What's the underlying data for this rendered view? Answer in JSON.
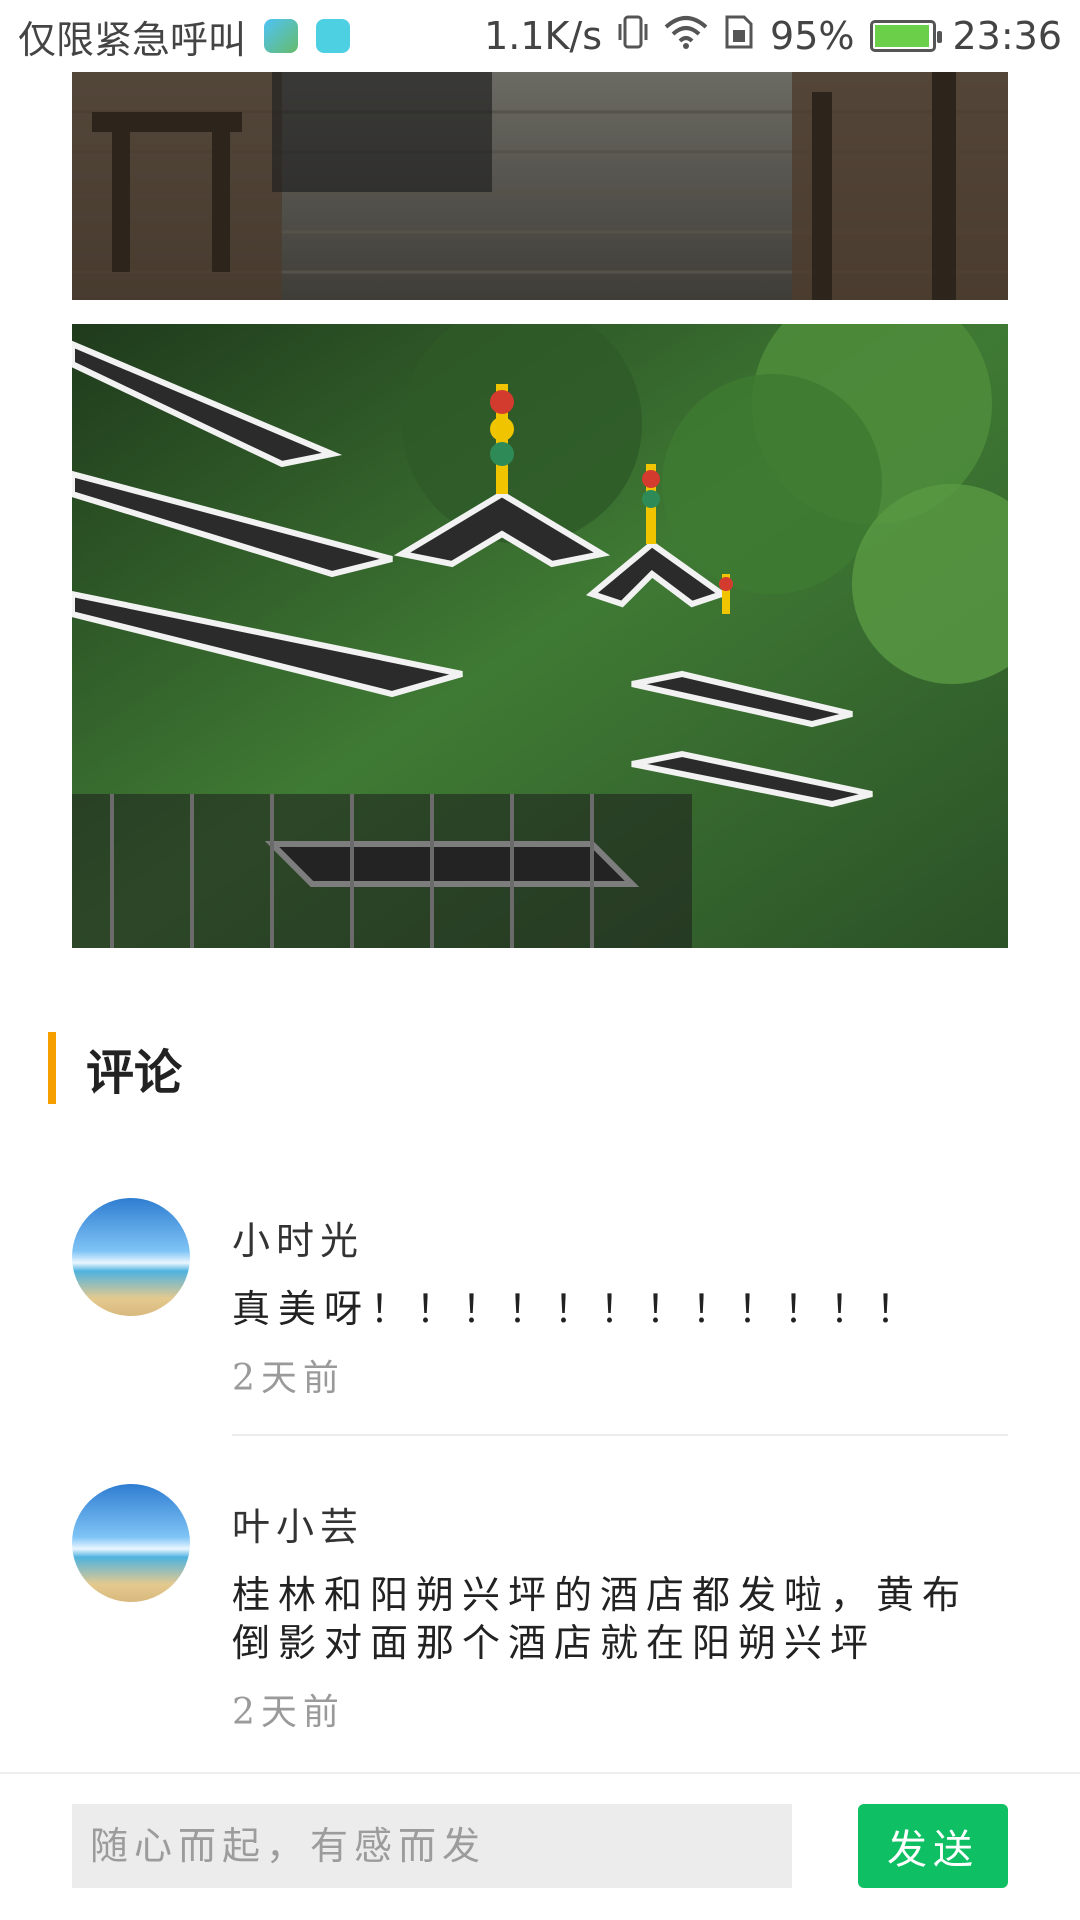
{
  "status_bar": {
    "left_text": "仅限紧急呼叫",
    "network_speed": "1.1K/s",
    "battery_level": "95%",
    "time": "23:36",
    "battery_fill_percent": 95
  },
  "comments_section": {
    "title": "评论"
  },
  "comments": [
    {
      "user": "小时光",
      "text": "真美呀！！！！！！！！！！！！",
      "time": "2天前"
    },
    {
      "user": "叶小芸",
      "text": "桂林和阳朔兴坪的酒店都发啦，黄布倒影对面那个酒店就在阳朔兴坪",
      "time": "2天前"
    }
  ],
  "input_bar": {
    "placeholder": "随心而起，有感而发",
    "send_label": "发送"
  },
  "colors": {
    "accent": "#f5a000",
    "send_button": "#0fbf63"
  }
}
